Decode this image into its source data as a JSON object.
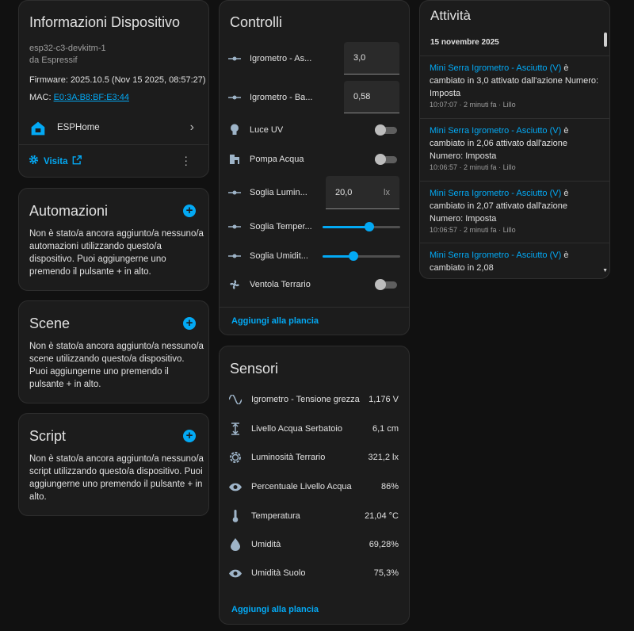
{
  "device_info": {
    "title": "Informazioni Dispositivo",
    "model": "esp32-c3-devkitm-1",
    "manufacturer": "da Espressif",
    "firmware": "Firmware: 2025.10.5 (Nov 15 2025, 08:57:27)",
    "mac_label": "MAC:",
    "mac_value": "E0:3A:B8:BF:E3:44",
    "integration_name": "ESPHome",
    "visit_label": "Visita"
  },
  "automations": {
    "title": "Automazioni",
    "text": "Non è stato/a ancora aggiunto/a nessuno/a automazioni utilizzando questo/a dispositivo. Puoi aggiungerne uno premendo il pulsante + in alto."
  },
  "scenes": {
    "title": "Scene",
    "text": "Non è stato/a ancora aggiunto/a nessuno/a scene utilizzando questo/a dispositivo. Puoi aggiungerne uno premendo il pulsante + in alto."
  },
  "scripts": {
    "title": "Script",
    "text": "Non è stato/a ancora aggiunto/a nessuno/a script utilizzando questo/a dispositivo. Puoi aggiungerne uno premendo il pulsante + in alto."
  },
  "controls": {
    "title": "Controlli",
    "items": [
      {
        "label": "Igrometro - As...",
        "type": "number",
        "value": "3,0",
        "icon": "ray-vertex-icon"
      },
      {
        "label": "Igrometro - Ba...",
        "type": "number",
        "value": "0,58",
        "icon": "ray-vertex-icon"
      },
      {
        "label": "Luce UV",
        "type": "toggle",
        "state": "off",
        "icon": "lightbulb-icon"
      },
      {
        "label": "Pompa Acqua",
        "type": "toggle",
        "state": "off",
        "icon": "water-pump-icon"
      },
      {
        "label": "Soglia Lumin...",
        "type": "number",
        "value": "20,0",
        "unit": "lx",
        "icon": "ray-vertex-icon"
      },
      {
        "label": "Soglia Temper...",
        "type": "slider",
        "level": 0.6,
        "icon": "ray-vertex-icon"
      },
      {
        "label": "Soglia Umidit...",
        "type": "slider",
        "level": 0.4,
        "icon": "ray-vertex-icon"
      },
      {
        "label": "Ventola Terrario",
        "type": "toggle",
        "state": "off",
        "icon": "fan-icon"
      }
    ],
    "add_label": "Aggiungi alla plancia"
  },
  "sensors": {
    "title": "Sensori",
    "items": [
      {
        "label": "Igrometro - Tensione grezza",
        "value": "1,176 V",
        "icon": "sine-wave-icon"
      },
      {
        "label": "Livello Acqua Serbatoio",
        "value": "6,1 cm",
        "icon": "arrow-expand-vertical-icon"
      },
      {
        "label": "Luminosità Terrario",
        "value": "321,2 lx",
        "icon": "brightness-icon"
      },
      {
        "label": "Percentuale Livello Acqua",
        "value": "86%",
        "icon": "eye-icon"
      },
      {
        "label": "Temperatura",
        "value": "21,04 °C",
        "icon": "thermometer-icon"
      },
      {
        "label": "Umidità",
        "value": "69,28%",
        "icon": "water-percent-icon"
      },
      {
        "label": "Umidità Suolo",
        "value": "75,3%",
        "icon": "eye-icon"
      }
    ],
    "add_label": "Aggiungi alla plancia"
  },
  "activity": {
    "title": "Attività",
    "date": "15 novembre 2025",
    "entries": [
      {
        "entity": "Mini Serra Igrometro - Asciutto (V)",
        "after": " è",
        "text": "cambiato in 3,0 attivato dall'azione Numero: Imposta",
        "time": "10:07:07",
        "ago": "2 minuti fa",
        "who": "Lillo"
      },
      {
        "entity": "Mini Serra Igrometro - Asciutto (V)",
        "after": " è",
        "text": "cambiato in 2,06 attivato dall'azione Numero: Imposta",
        "time": "10:06:57",
        "ago": "2 minuti fa",
        "who": "Lillo"
      },
      {
        "entity": "Mini Serra Igrometro - Asciutto (V)",
        "after": " è",
        "text": "cambiato in 2,07 attivato dall'azione Numero: Imposta",
        "time": "10:06:57",
        "ago": "2 minuti fa",
        "who": "Lillo"
      },
      {
        "entity": "Mini Serra Igrometro - Asciutto (V)",
        "after": " è",
        "text": "cambiato in 2,08",
        "time": "",
        "ago": "",
        "who": ""
      }
    ]
  },
  "colors": {
    "accent": "#03a9f4",
    "background": "#111111",
    "card": "#1c1c1c",
    "text": "#e1e1e1"
  }
}
